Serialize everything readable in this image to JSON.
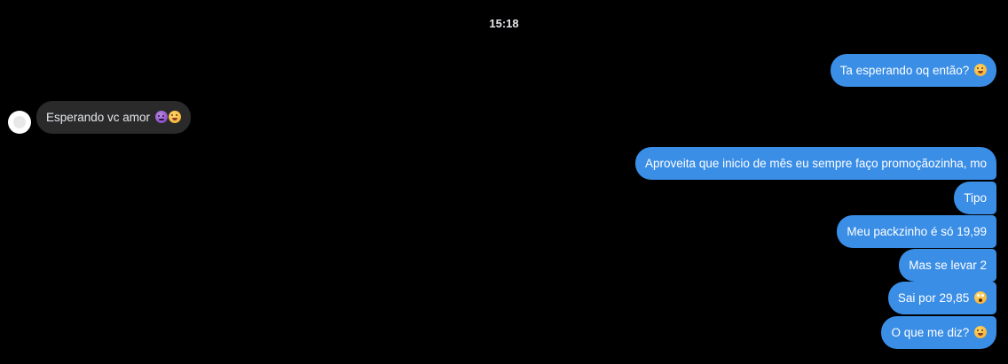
{
  "conversation": {
    "timestamp": "15:18",
    "messages": [
      {
        "direction": "outgoing",
        "text": "Ta esperando oq então?",
        "emoji": "grimace-face-emoji"
      },
      {
        "direction": "incoming",
        "text": "Esperando vc amor",
        "emoji": [
          "smiling-devil-emoji",
          "tongue-face-emoji"
        ]
      },
      {
        "direction": "outgoing",
        "text": "Aproveita que inicio de mês eu sempre faço promoçãozinha, mo"
      },
      {
        "direction": "outgoing",
        "text": "Tipo"
      },
      {
        "direction": "outgoing",
        "text": "Meu packzinho é só 19,99"
      },
      {
        "direction": "outgoing",
        "text": "Mas se levar 2"
      },
      {
        "direction": "outgoing",
        "text": "Sai por 29,85",
        "emoji": "astonished-face-emoji"
      },
      {
        "direction": "outgoing",
        "text": "O que me diz?",
        "emoji": "grimace-face-emoji"
      }
    ]
  },
  "colors": {
    "background": "#000000",
    "outgoing_bubble": "#3a8ee6",
    "incoming_bubble": "#2a2a2a",
    "text": "#ffffff"
  }
}
